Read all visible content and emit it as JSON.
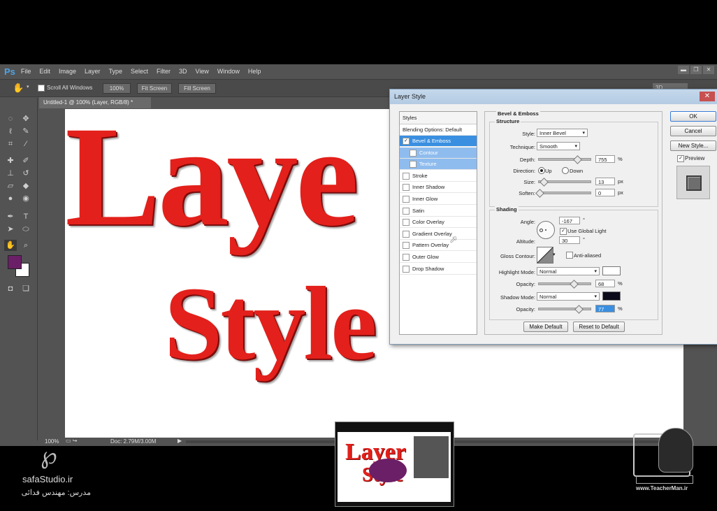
{
  "app": {
    "logo": "Ps",
    "menu": [
      "File",
      "Edit",
      "Image",
      "Layer",
      "Type",
      "Select",
      "Filter",
      "3D",
      "View",
      "Window",
      "Help"
    ],
    "window_buttons": [
      "▬",
      "❐",
      "✕"
    ]
  },
  "options_bar": {
    "scroll_all_windows": "Scroll All Windows",
    "zoom_100": "100%",
    "fit_screen": "Fit Screen",
    "fill_screen": "Fill Screen",
    "workspace": "3D"
  },
  "document": {
    "tab_title": "Untitled-1 @ 100% (Layer, RGB/8) *",
    "canvas_text_line1": "Laye",
    "canvas_text_line2": "Style",
    "text_color": "#e3201b"
  },
  "status": {
    "zoom": "100%",
    "doc_size": "Doc: 2.79M/3.00M"
  },
  "colors": {
    "foreground": "#6b1f66",
    "background": "#ffffff"
  },
  "dialog": {
    "title": "Layer Style",
    "styles_header": "Styles",
    "blending_options": "Blending Options: Default",
    "styles": [
      {
        "label": "Bevel & Emboss",
        "checked": true,
        "selected": true
      },
      {
        "label": "Contour",
        "checked": false,
        "sub": true
      },
      {
        "label": "Texture",
        "checked": false,
        "sub": true
      },
      {
        "label": "Stroke",
        "checked": false
      },
      {
        "label": "Inner Shadow",
        "checked": false
      },
      {
        "label": "Inner Glow",
        "checked": false
      },
      {
        "label": "Satin",
        "checked": false
      },
      {
        "label": "Color Overlay",
        "checked": false
      },
      {
        "label": "Gradient Overlay",
        "checked": false
      },
      {
        "label": "Pattern Overlay",
        "checked": false
      },
      {
        "label": "Outer Glow",
        "checked": false
      },
      {
        "label": "Drop Shadow",
        "checked": false
      }
    ],
    "section_title": "Bevel & Emboss",
    "structure": {
      "header": "Structure",
      "style_label": "Style:",
      "style_value": "Inner Bevel",
      "technique_label": "Technique:",
      "technique_value": "Smooth",
      "depth_label": "Depth:",
      "depth_value": "755",
      "depth_unit": "%",
      "direction_label": "Direction:",
      "dir_up": "Up",
      "dir_down": "Down",
      "size_label": "Size:",
      "size_value": "13",
      "size_unit": "px",
      "soften_label": "Soften:",
      "soften_value": "0",
      "soften_unit": "px"
    },
    "shading": {
      "header": "Shading",
      "angle_label": "Angle:",
      "angle_value": "-167",
      "angle_unit": "°",
      "use_global_light": "Use Global Light",
      "altitude_label": "Altitude:",
      "altitude_value": "30",
      "altitude_unit": "°",
      "gloss_label": "Gloss Contour:",
      "anti_aliased": "Anti-aliased",
      "highlight_mode_label": "Highlight Mode:",
      "highlight_mode_value": "Normal",
      "highlight_color": "#ffffff",
      "highlight_opacity_label": "Opacity:",
      "highlight_opacity_value": "68",
      "highlight_opacity_unit": "%",
      "shadow_mode_label": "Shadow Mode:",
      "shadow_mode_value": "Normal",
      "shadow_color": "#0a0a1a",
      "shadow_opacity_label": "Opacity:",
      "shadow_opacity_value": "77",
      "shadow_opacity_unit": "%"
    },
    "make_default": "Make Default",
    "reset_default": "Reset to Default",
    "ok": "OK",
    "cancel": "Cancel",
    "new_style": "New Style...",
    "preview": "Preview"
  },
  "overlay": {
    "left_brand": "safaStudio.ir",
    "left_teacher": "مدرس: مهندس فدائی",
    "right_brand": "www.TeacherMan.ir",
    "thumb_text1": "Layer",
    "thumb_text2": "Style"
  }
}
